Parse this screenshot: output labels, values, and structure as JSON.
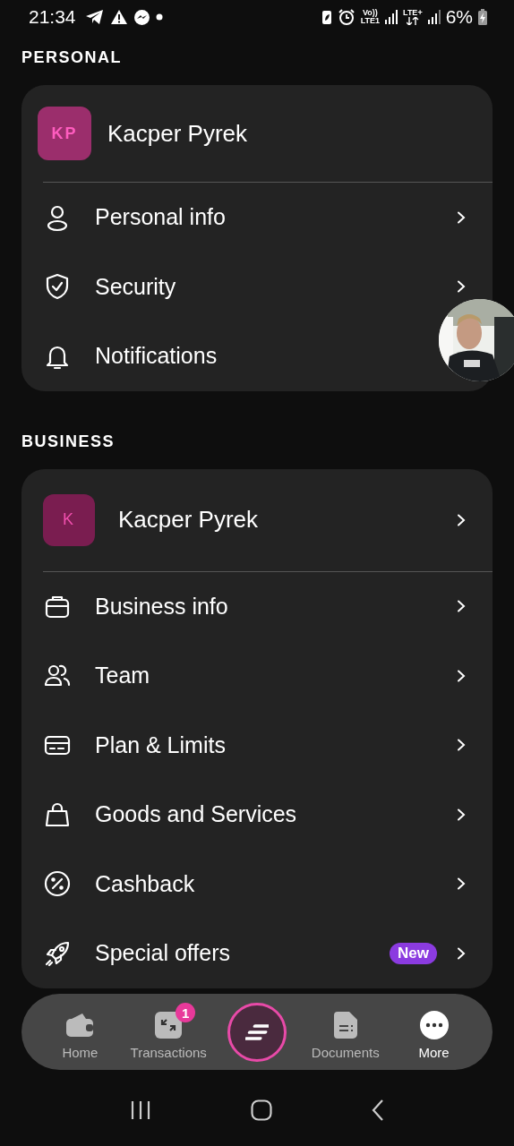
{
  "status_bar": {
    "time": "21:34",
    "network_labels": [
      "Vo))",
      "LTE1",
      "LTE+"
    ],
    "battery": "6%"
  },
  "sections": [
    {
      "title": "PERSONAL",
      "profile": {
        "initials": "KP",
        "name": "Kacper Pyrek",
        "chevron": false
      },
      "items": [
        {
          "kind": "person",
          "label": "Personal info",
          "chevron": true
        },
        {
          "kind": "shield",
          "label": "Security",
          "chevron": true
        },
        {
          "kind": "bell",
          "label": "Notifications",
          "chevron": false
        }
      ]
    },
    {
      "title": "BUSINESS",
      "profile": {
        "initials": "K",
        "name": "Kacper Pyrek",
        "chevron": true
      },
      "items": [
        {
          "kind": "briefcase",
          "label": "Business info",
          "chevron": true
        },
        {
          "kind": "team",
          "label": "Team",
          "chevron": true
        },
        {
          "kind": "card",
          "label": "Plan & Limits",
          "chevron": true
        },
        {
          "kind": "bag",
          "label": "Goods and Services",
          "chevron": true
        },
        {
          "kind": "percent",
          "label": "Cashback",
          "chevron": true
        },
        {
          "kind": "rocket",
          "label": "Special offers",
          "badge": "New",
          "chevron": true
        }
      ]
    }
  ],
  "bottom_nav": [
    {
      "kind": "tab",
      "label": "Home",
      "selected": false
    },
    {
      "kind": "tab",
      "label": "Transactions",
      "badge": "1",
      "selected": false
    },
    {
      "kind": "center",
      "selected": false
    },
    {
      "kind": "tab",
      "label": "Documents",
      "selected": false
    },
    {
      "kind": "tab",
      "label": "More",
      "selected": true
    }
  ]
}
